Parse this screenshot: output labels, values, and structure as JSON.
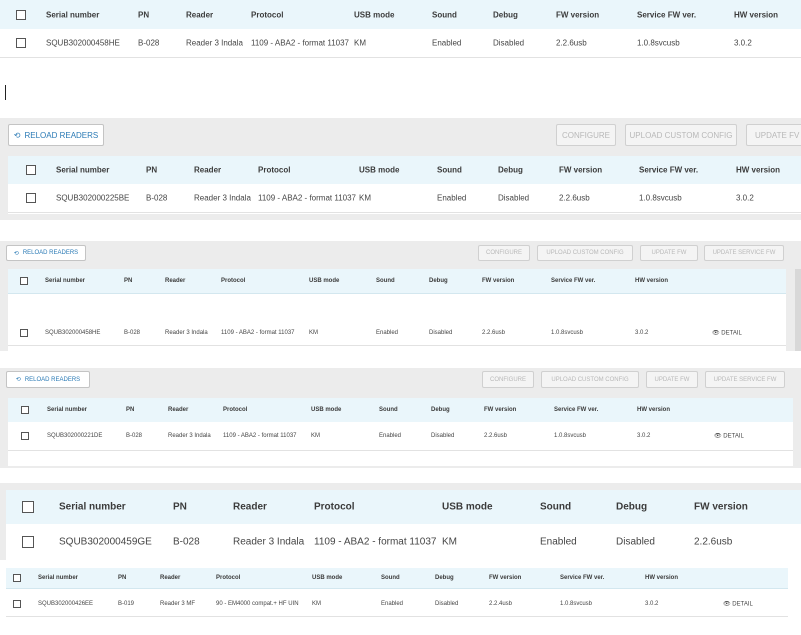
{
  "columns": {
    "serial": "Serial number",
    "pn": "PN",
    "reader": "Reader",
    "protocol": "Protocol",
    "usb": "USB mode",
    "sound": "Sound",
    "debug": "Debug",
    "fw": "FW version",
    "sfw": "Service FW ver.",
    "hw": "HW version"
  },
  "toolbar": {
    "reload": "RELOAD READERS",
    "configure": "CONFIGURE",
    "upload": "UPLOAD CUSTOM CONFIG",
    "update_fw": "UPDATE FW",
    "update_fw_truncated": "UPDATE FV",
    "update_service_fw": "UPDATE SERVICE FW",
    "reload_icon": "refresh-icon"
  },
  "detail_label": "DETAIL",
  "detail_icon": "eye-icon",
  "rows": [
    {
      "serial": "SQUB302000458HE",
      "pn": "B-028",
      "reader": "Reader 3 Indala",
      "protocol": "1109 - ABA2 - format 11037",
      "usb": "KM",
      "sound": "Enabled",
      "debug": "Disabled",
      "fw": "2.2.6usb",
      "sfw": "1.0.8svcusb",
      "hw": "3.0.2"
    },
    {
      "serial": "SQUB302000225BE",
      "pn": "B-028",
      "reader": "Reader 3 Indala",
      "protocol": "1109 - ABA2 - format 11037",
      "usb": "KM",
      "sound": "Enabled",
      "debug": "Disabled",
      "fw": "2.2.6usb",
      "sfw": "1.0.8svcusb",
      "hw": "3.0.2"
    },
    {
      "serial": "SQUB302000458HE",
      "pn": "B-028",
      "reader": "Reader 3 Indala",
      "protocol": "1109 - ABA2 - format 11037",
      "usb": "KM",
      "sound": "Enabled",
      "debug": "Disabled",
      "fw": "2.2.6usb",
      "sfw": "1.0.8svcusb",
      "hw": "3.0.2"
    },
    {
      "serial": "SQUB302000221DE",
      "pn": "B-028",
      "reader": "Reader 3 Indala",
      "protocol": "1109 - ABA2 - format 11037",
      "usb": "KM",
      "sound": "Enabled",
      "debug": "Disabled",
      "fw": "2.2.6usb",
      "sfw": "1.0.8svcusb",
      "hw": "3.0.2"
    },
    {
      "serial": "SQUB302000459GE",
      "pn": "B-028",
      "reader": "Reader 3 Indala",
      "protocol": "1109 - ABA2 - format 11037",
      "usb": "KM",
      "sound": "Enabled",
      "debug": "Disabled",
      "fw": "2.2.6usb"
    },
    {
      "serial": "SQUB302000426EE",
      "pn": "B-019",
      "reader": "Reader 3 MF",
      "protocol": "90 - EM4000 compat.+ HF UIN",
      "usb": "KM",
      "sound": "Enabled",
      "debug": "Disabled",
      "fw": "2.2.4usb",
      "sfw": "1.0.8svcusb",
      "hw": "3.0.2"
    }
  ]
}
